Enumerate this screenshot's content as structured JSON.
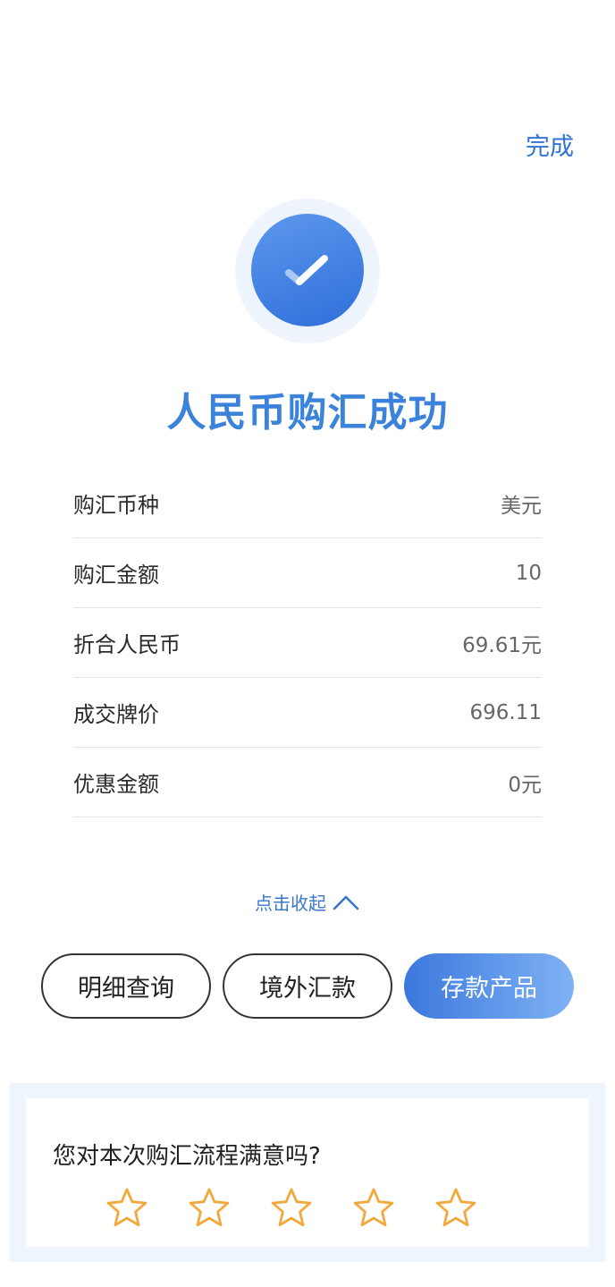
{
  "header": {
    "done_label": "完成"
  },
  "result": {
    "title": "人民币购汇成功"
  },
  "details": [
    {
      "label": "购汇币种",
      "value": "美元"
    },
    {
      "label": "购汇金额",
      "value": "10"
    },
    {
      "label": "折合人民币",
      "value": "69.61元"
    },
    {
      "label": "成交牌价",
      "value": "696.11"
    },
    {
      "label": "优惠金额",
      "value": "0元"
    }
  ],
  "collapse": {
    "label": "点击收起",
    "icon": "chevron-up-icon"
  },
  "actions": {
    "detail_query": "明细查询",
    "overseas_remit": "境外汇款",
    "deposit_products": "存款产品"
  },
  "rating": {
    "question": "您对本次购汇流程满意吗?",
    "star_count": 5
  },
  "colors": {
    "accent": "#2f74d6",
    "title": "#3b82db",
    "star": "#f0a93a",
    "primary_gradient_start": "#3b78dd",
    "primary_gradient_end": "#7fb2f4"
  }
}
